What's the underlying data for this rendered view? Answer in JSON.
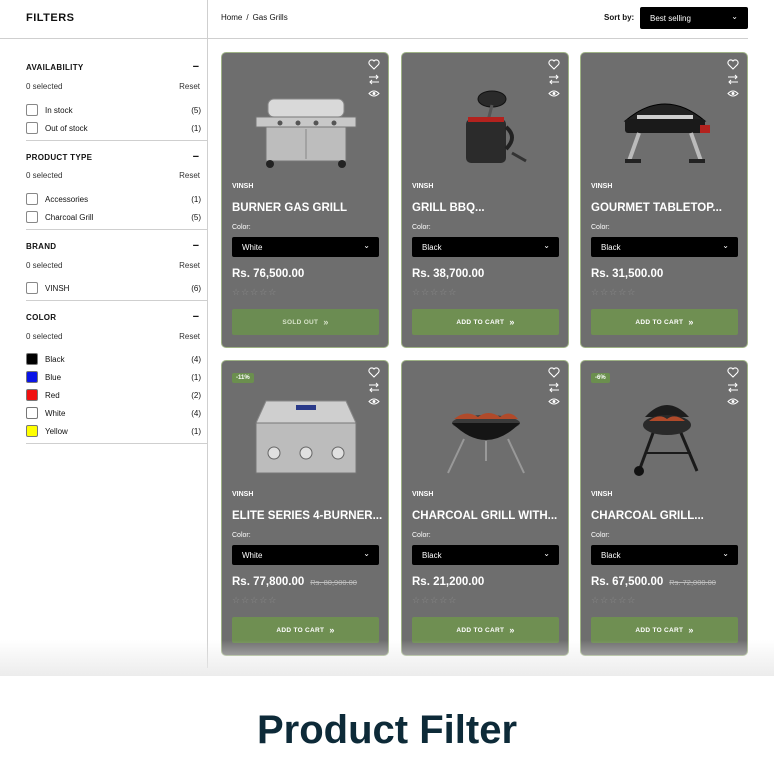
{
  "sidebar": {
    "title": "FILTERS",
    "groups": [
      {
        "title": "AVAILABILITY",
        "toggle": "−",
        "selected": "0 selected",
        "reset": "Reset",
        "options": [
          {
            "label": "In stock",
            "count": "(5)"
          },
          {
            "label": "Out of stock",
            "count": "(1)"
          }
        ]
      },
      {
        "title": "PRODUCT TYPE",
        "toggle": "−",
        "selected": "0 selected",
        "reset": "Reset",
        "options": [
          {
            "label": "Accessories",
            "count": "(1)"
          },
          {
            "label": "Charcoal Grill",
            "count": "(5)"
          }
        ]
      },
      {
        "title": "BRAND",
        "toggle": "−",
        "selected": "0 selected",
        "reset": "Reset",
        "options": [
          {
            "label": "VINSH",
            "count": "(6)"
          }
        ]
      },
      {
        "title": "COLOR",
        "toggle": "−",
        "selected": "0 selected",
        "reset": "Reset",
        "options": [
          {
            "label": "Black",
            "count": "(4)",
            "swatch": "#000000"
          },
          {
            "label": "Blue",
            "count": "(1)",
            "swatch": "#0a14e6"
          },
          {
            "label": "Red",
            "count": "(2)",
            "swatch": "#f01010"
          },
          {
            "label": "White",
            "count": "(4)",
            "swatch": "#ffffff"
          },
          {
            "label": "Yellow",
            "count": "(1)",
            "swatch": "#ffff00"
          }
        ]
      }
    ]
  },
  "breadcrumb": {
    "home": "Home",
    "sep": "/",
    "current": "Gas Grills"
  },
  "sort": {
    "label": "Sort by:",
    "value": "Best selling"
  },
  "products": [
    {
      "vendor": "VINSH",
      "name": "BURNER GAS GRILL",
      "color_label": "Color:",
      "color_value": "White",
      "price": "Rs. 76,500.00",
      "old_price": "",
      "badge": "",
      "button": "SOLD OUT",
      "stars": "☆☆☆☆☆"
    },
    {
      "vendor": "VINSH",
      "name": "GRILL BBQ...",
      "color_label": "Color:",
      "color_value": "Black",
      "price": "Rs. 38,700.00",
      "old_price": "",
      "badge": "",
      "button": "ADD TO CART",
      "stars": "☆☆☆☆☆"
    },
    {
      "vendor": "VINSH",
      "name": "GOURMET TABLETOP...",
      "color_label": "Color:",
      "color_value": "Black",
      "price": "Rs. 31,500.00",
      "old_price": "",
      "badge": "",
      "button": "ADD TO CART",
      "stars": "☆☆☆☆☆"
    },
    {
      "vendor": "VINSH",
      "name": "ELITE SERIES 4-BURNER...",
      "color_label": "Color:",
      "color_value": "White",
      "price": "Rs. 77,800.00",
      "old_price": "Rs. 80,900.00",
      "badge": "-11%",
      "button": "ADD TO CART",
      "stars": "☆☆☆☆☆"
    },
    {
      "vendor": "VINSH",
      "name": "CHARCOAL GRILL WITH...",
      "color_label": "Color:",
      "color_value": "Black",
      "price": "Rs. 21,200.00",
      "old_price": "",
      "badge": "",
      "button": "ADD TO CART",
      "stars": "☆☆☆☆☆"
    },
    {
      "vendor": "VINSH",
      "name": "CHARCOAL GRILL...",
      "color_label": "Color:",
      "color_value": "Black",
      "price": "Rs. 67,500.00",
      "old_price": "Rs. 72,000.00",
      "badge": "-6%",
      "button": "ADD TO CART",
      "stars": "☆☆☆☆☆"
    }
  ],
  "icons": {
    "wishlist": "heart-icon",
    "compare": "compare-arrows-icon",
    "quickview": "eye-icon",
    "select_chevron": "double-chevron-down-icon",
    "button_arrows": "double-chevron-right-icon"
  },
  "colors": {
    "card_bg": "#6e6e6e",
    "button_green": "#6f8f52",
    "footer_text": "#0d2a38"
  },
  "footer": {
    "title": "Product Filter"
  }
}
